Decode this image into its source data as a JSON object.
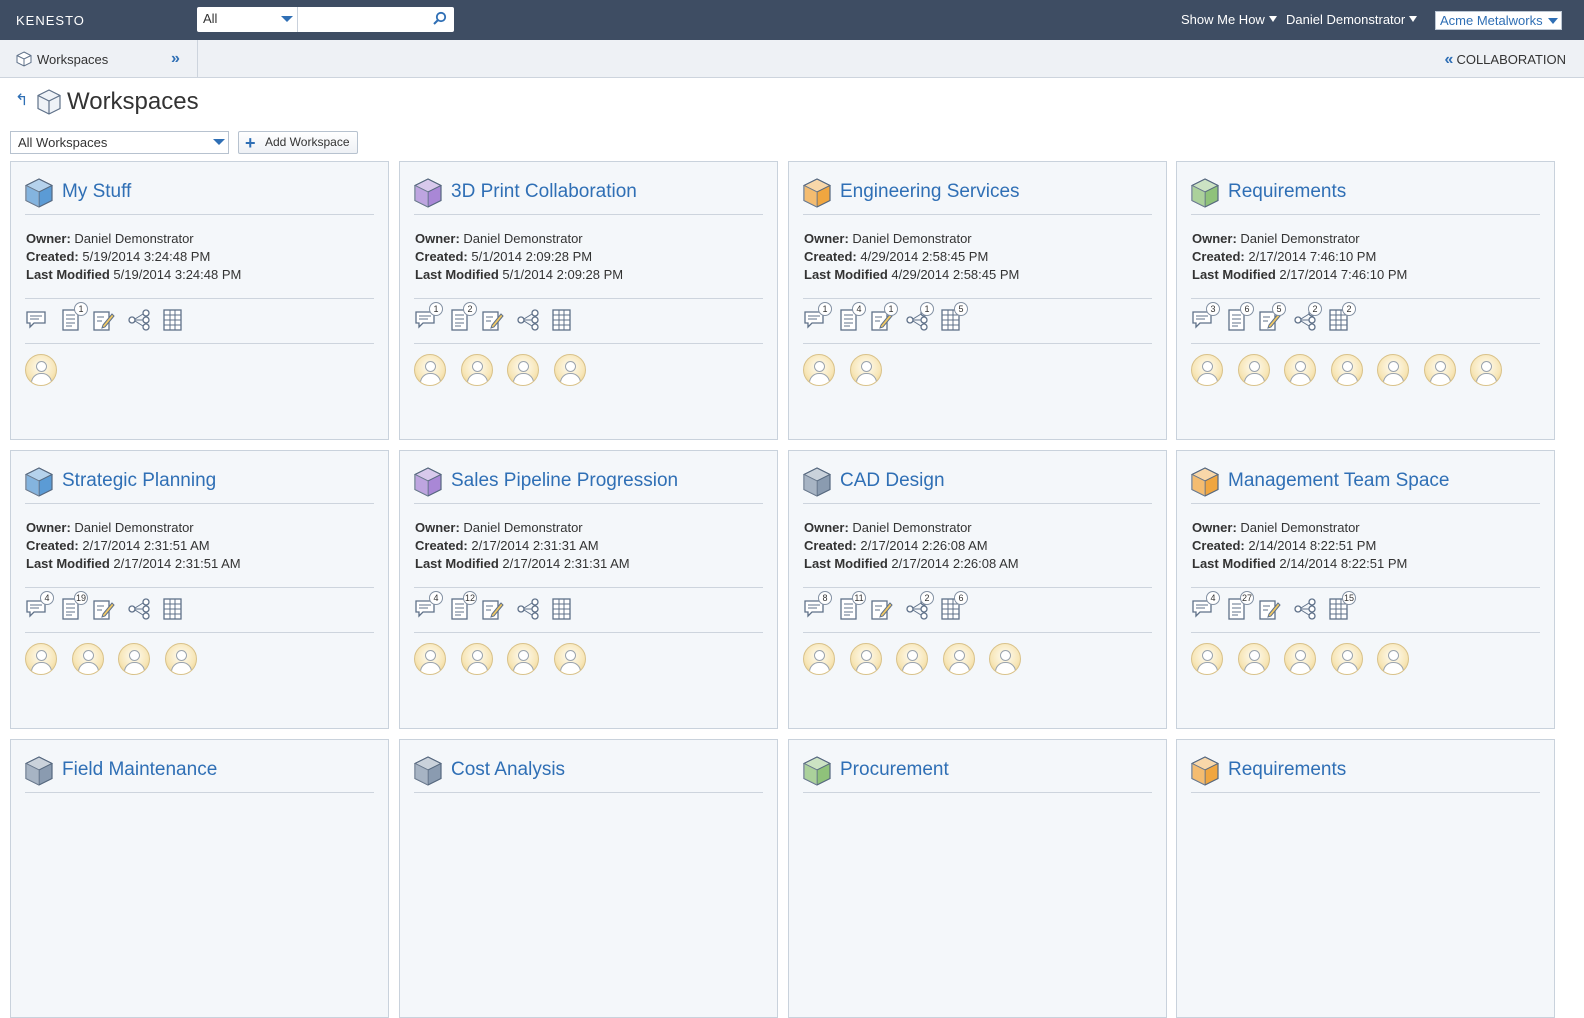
{
  "app": {
    "logo": "KENESTO"
  },
  "search": {
    "scope": "All",
    "placeholder": ""
  },
  "topnav": {
    "show_me_how": "Show Me How",
    "user": "Daniel Demonstrator",
    "tenant": "Acme Metalworks"
  },
  "subbar": {
    "workspaces_label": "Workspaces",
    "collaboration_label": "COLLABORATION"
  },
  "page": {
    "title": "Workspaces",
    "filter_value": "All Workspaces",
    "add_button": "Add Workspace"
  },
  "labels": {
    "owner": "Owner:",
    "created": "Created:",
    "last_modified": "Last Modified"
  },
  "colors": {
    "accent": "#2f6fb5",
    "topbar": "#3e4d63",
    "blue_cube": "#5b9bd5",
    "purple_cube": "#a987d6",
    "orange_cube": "#f0a640",
    "green_cube": "#8fc27a",
    "gray_cube": "#8a9bb0"
  },
  "workspaces": [
    {
      "name": "My Stuff",
      "cube": "blue",
      "owner": "Daniel Demonstrator",
      "created": "5/19/2014 3:24:48 PM",
      "modified": "5/19/2014 3:24:48 PM",
      "badges": [
        "",
        "1",
        "",
        "",
        ""
      ],
      "members": 1
    },
    {
      "name": "3D Print Collaboration",
      "cube": "purple",
      "owner": "Daniel Demonstrator",
      "created": "5/1/2014 2:09:28 PM",
      "modified": "5/1/2014 2:09:28 PM",
      "badges": [
        "1",
        "2",
        "",
        "",
        ""
      ],
      "members": 4
    },
    {
      "name": "Engineering Services",
      "cube": "orange",
      "owner": "Daniel Demonstrator",
      "created": "4/29/2014 2:58:45 PM",
      "modified": "4/29/2014 2:58:45 PM",
      "badges": [
        "1",
        "4",
        "1",
        "1",
        "5"
      ],
      "members": 2
    },
    {
      "name": "Requirements",
      "cube": "green",
      "owner": "Daniel Demonstrator",
      "created": "2/17/2014 7:46:10 PM",
      "modified": "2/17/2014 7:46:10 PM",
      "badges": [
        "3",
        "6",
        "5",
        "2",
        "2"
      ],
      "members": 7
    },
    {
      "name": "Strategic Planning",
      "cube": "blue",
      "owner": "Daniel Demonstrator",
      "created": "2/17/2014 2:31:51 AM",
      "modified": "2/17/2014 2:31:51 AM",
      "badges": [
        "4",
        "19",
        "",
        "",
        ""
      ],
      "members": 4
    },
    {
      "name": "Sales Pipeline Progression",
      "cube": "purple",
      "owner": "Daniel Demonstrator",
      "created": "2/17/2014 2:31:31 AM",
      "modified": "2/17/2014 2:31:31 AM",
      "badges": [
        "4",
        "12",
        "",
        "",
        ""
      ],
      "members": 4
    },
    {
      "name": "CAD Design",
      "cube": "gray",
      "owner": "Daniel Demonstrator",
      "created": "2/17/2014 2:26:08 AM",
      "modified": "2/17/2014 2:26:08 AM",
      "badges": [
        "8",
        "11",
        "",
        "2",
        "6"
      ],
      "members": 5
    },
    {
      "name": "Management Team Space",
      "cube": "orange",
      "owner": "Daniel Demonstrator",
      "created": "2/14/2014 8:22:51 PM",
      "modified": "2/14/2014 8:22:51 PM",
      "badges": [
        "4",
        "27",
        "",
        "",
        "15"
      ],
      "members": 5
    },
    {
      "name": "Field Maintenance",
      "cube": "gray",
      "owner": "",
      "created": "",
      "modified": "",
      "badges": [
        "",
        "",
        "",
        "",
        ""
      ],
      "members": 0
    },
    {
      "name": "Cost Analysis",
      "cube": "gray",
      "owner": "",
      "created": "",
      "modified": "",
      "badges": [
        "",
        "",
        "",
        "",
        ""
      ],
      "members": 0
    },
    {
      "name": "Procurement",
      "cube": "green",
      "owner": "",
      "created": "",
      "modified": "",
      "badges": [
        "",
        "",
        "",
        "",
        ""
      ],
      "members": 0
    },
    {
      "name": "Requirements",
      "cube": "orange",
      "owner": "",
      "created": "",
      "modified": "",
      "badges": [
        "",
        "",
        "",
        "",
        ""
      ],
      "members": 0
    }
  ]
}
